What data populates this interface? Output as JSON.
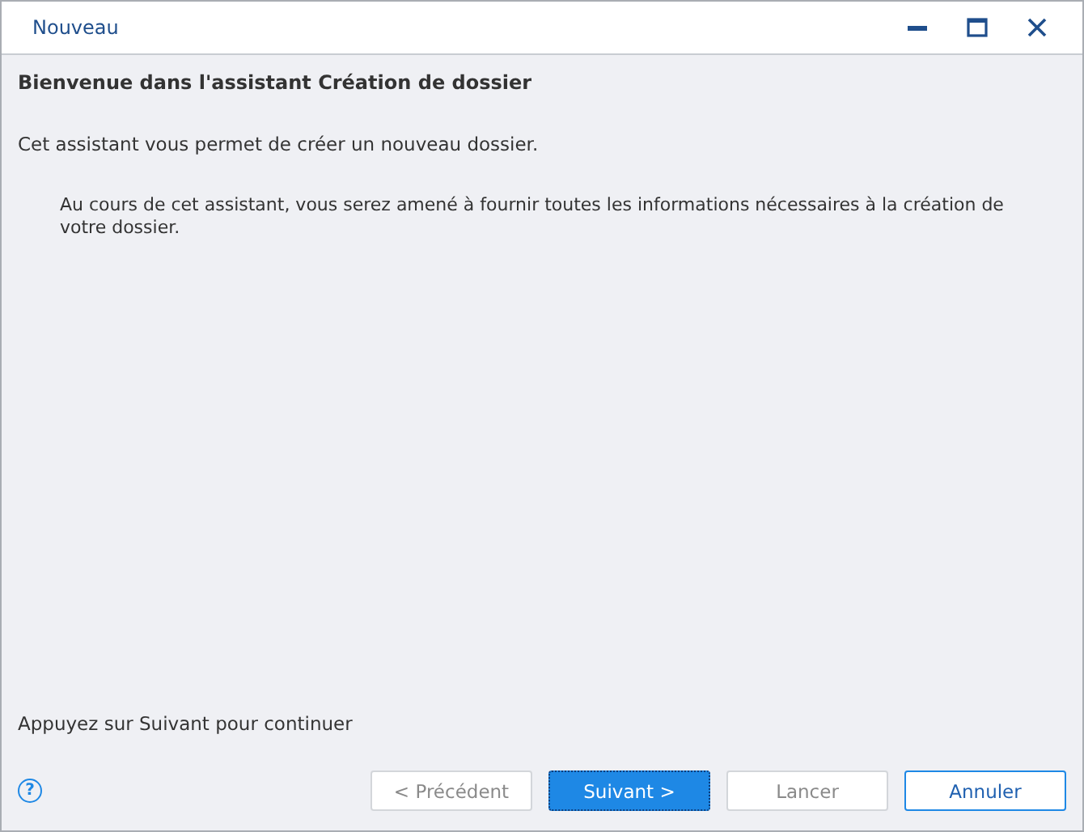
{
  "window": {
    "title": "Nouveau"
  },
  "heading": "Bienvenue dans l'assistant Création de dossier",
  "intro": "Cet assistant vous permet de créer un nouveau dossier.",
  "details": "Au cours de cet assistant, vous serez amené à fournir toutes les informations nécessaires à la création de votre dossier.",
  "hint": "Appuyez sur Suivant pour continuer",
  "help": "?",
  "buttons": [
    {
      "label": "< Précédent",
      "disabled": true,
      "default": false
    },
    {
      "label": "Suivant >",
      "disabled": false,
      "default": true
    },
    {
      "label": "Lancer",
      "disabled": true,
      "default": false
    },
    {
      "label": "Annuler",
      "disabled": false,
      "default": false
    }
  ]
}
